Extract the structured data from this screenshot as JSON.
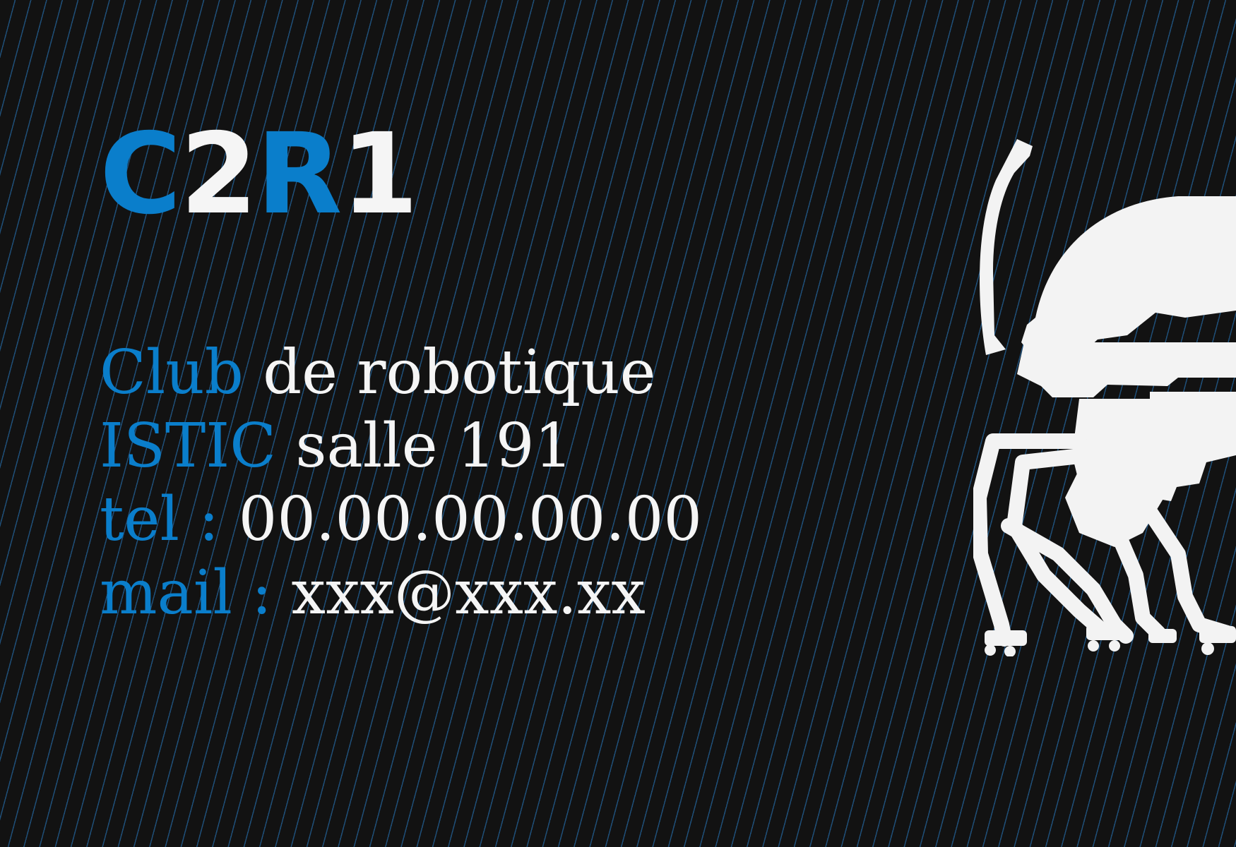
{
  "colors": {
    "accent": "#0a7ecb",
    "text": "#f5f5f5",
    "background": "#121212",
    "stripe": "#1f4f78"
  },
  "title": {
    "c": "C",
    "two": "2",
    "r": "R",
    "one": "1"
  },
  "lines": [
    {
      "key": "Club",
      "value": "de robotique"
    },
    {
      "key": "ISTIC",
      "value": "salle 191"
    },
    {
      "key": "tel :",
      "value": "00.00.00.00.00"
    },
    {
      "key": "mail :",
      "value": "xxx@xxx.xx"
    }
  ],
  "logo": {
    "icon": "robot-mascot-icon"
  }
}
